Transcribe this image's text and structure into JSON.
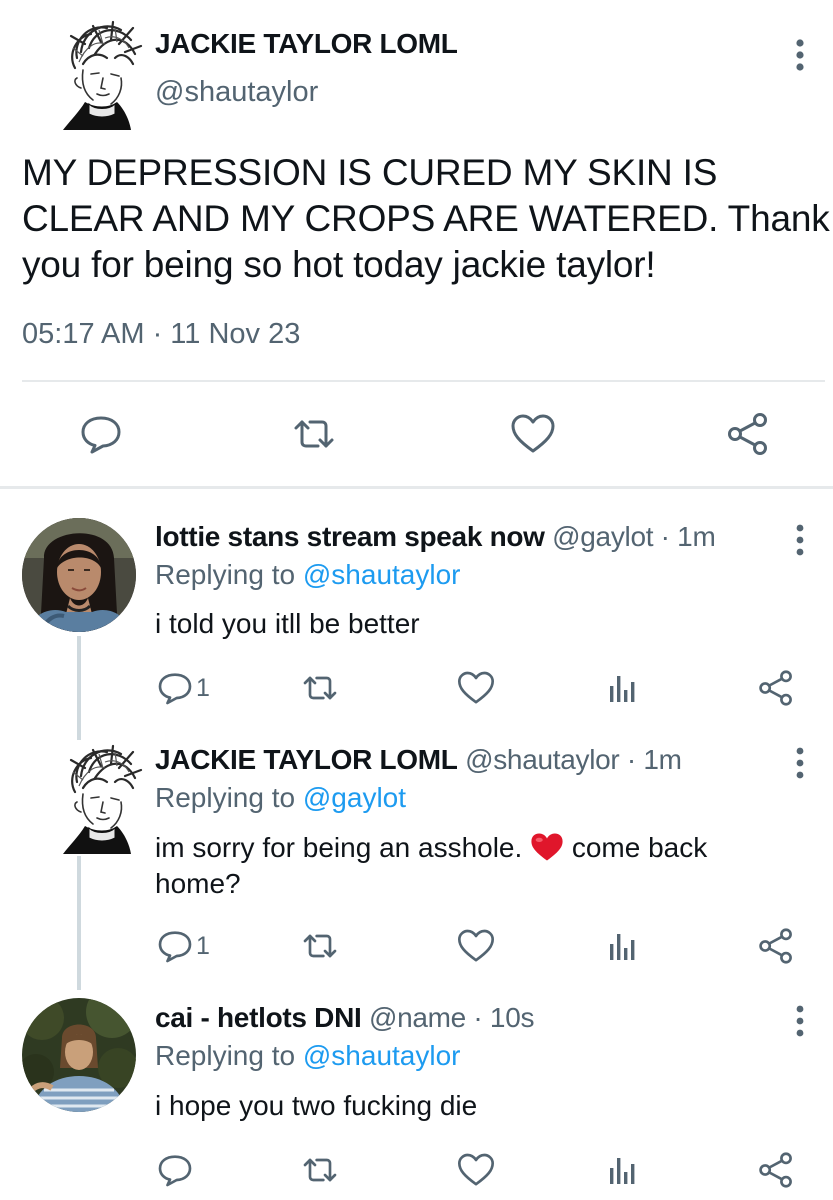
{
  "main_tweet": {
    "display_name": "JACKIE TAYLOR LOML",
    "handle": "@shautaylor",
    "text": "MY DEPRESSION IS CURED MY SKIN IS CLEAR AND MY CROPS ARE WATERED. Thank you for being so hot today jackie taylor!",
    "timestamp": "05:17 AM · 11 Nov 23",
    "actions": [
      "reply-icon",
      "retweet-icon",
      "like-icon",
      "share-icon"
    ]
  },
  "replies": [
    {
      "display_name": "lottie stans stream speak now",
      "handle": "@gaylot",
      "age": " · 1m",
      "replying_prefix": "Replying to ",
      "replying_to": "@shautaylor",
      "text": "i told you itll be better",
      "reply_count": "1"
    },
    {
      "display_name": "JACKIE TAYLOR LOML",
      "handle": "@shautaylor",
      "age": " · 1m",
      "replying_prefix": "Replying to ",
      "replying_to": "@gaylot",
      "text_before": "im sorry for being an asshole. ",
      "emoji": "red-heart-emoji",
      "text_after": " come back",
      "text_line2": "home?",
      "reply_count": "1"
    },
    {
      "display_name": "cai - hetlots DNI",
      "handle": "@name",
      "age": " · 10s",
      "replying_prefix": "Replying to ",
      "replying_to": "@shautaylor",
      "text": "i hope you two fucking die"
    }
  ],
  "colors": {
    "text": "#0f1419",
    "secondary": "#536471",
    "link": "#1d9bf0",
    "divider": "#e6e9eb",
    "thread_line": "#cfd9de",
    "heart": "#e0162b"
  }
}
